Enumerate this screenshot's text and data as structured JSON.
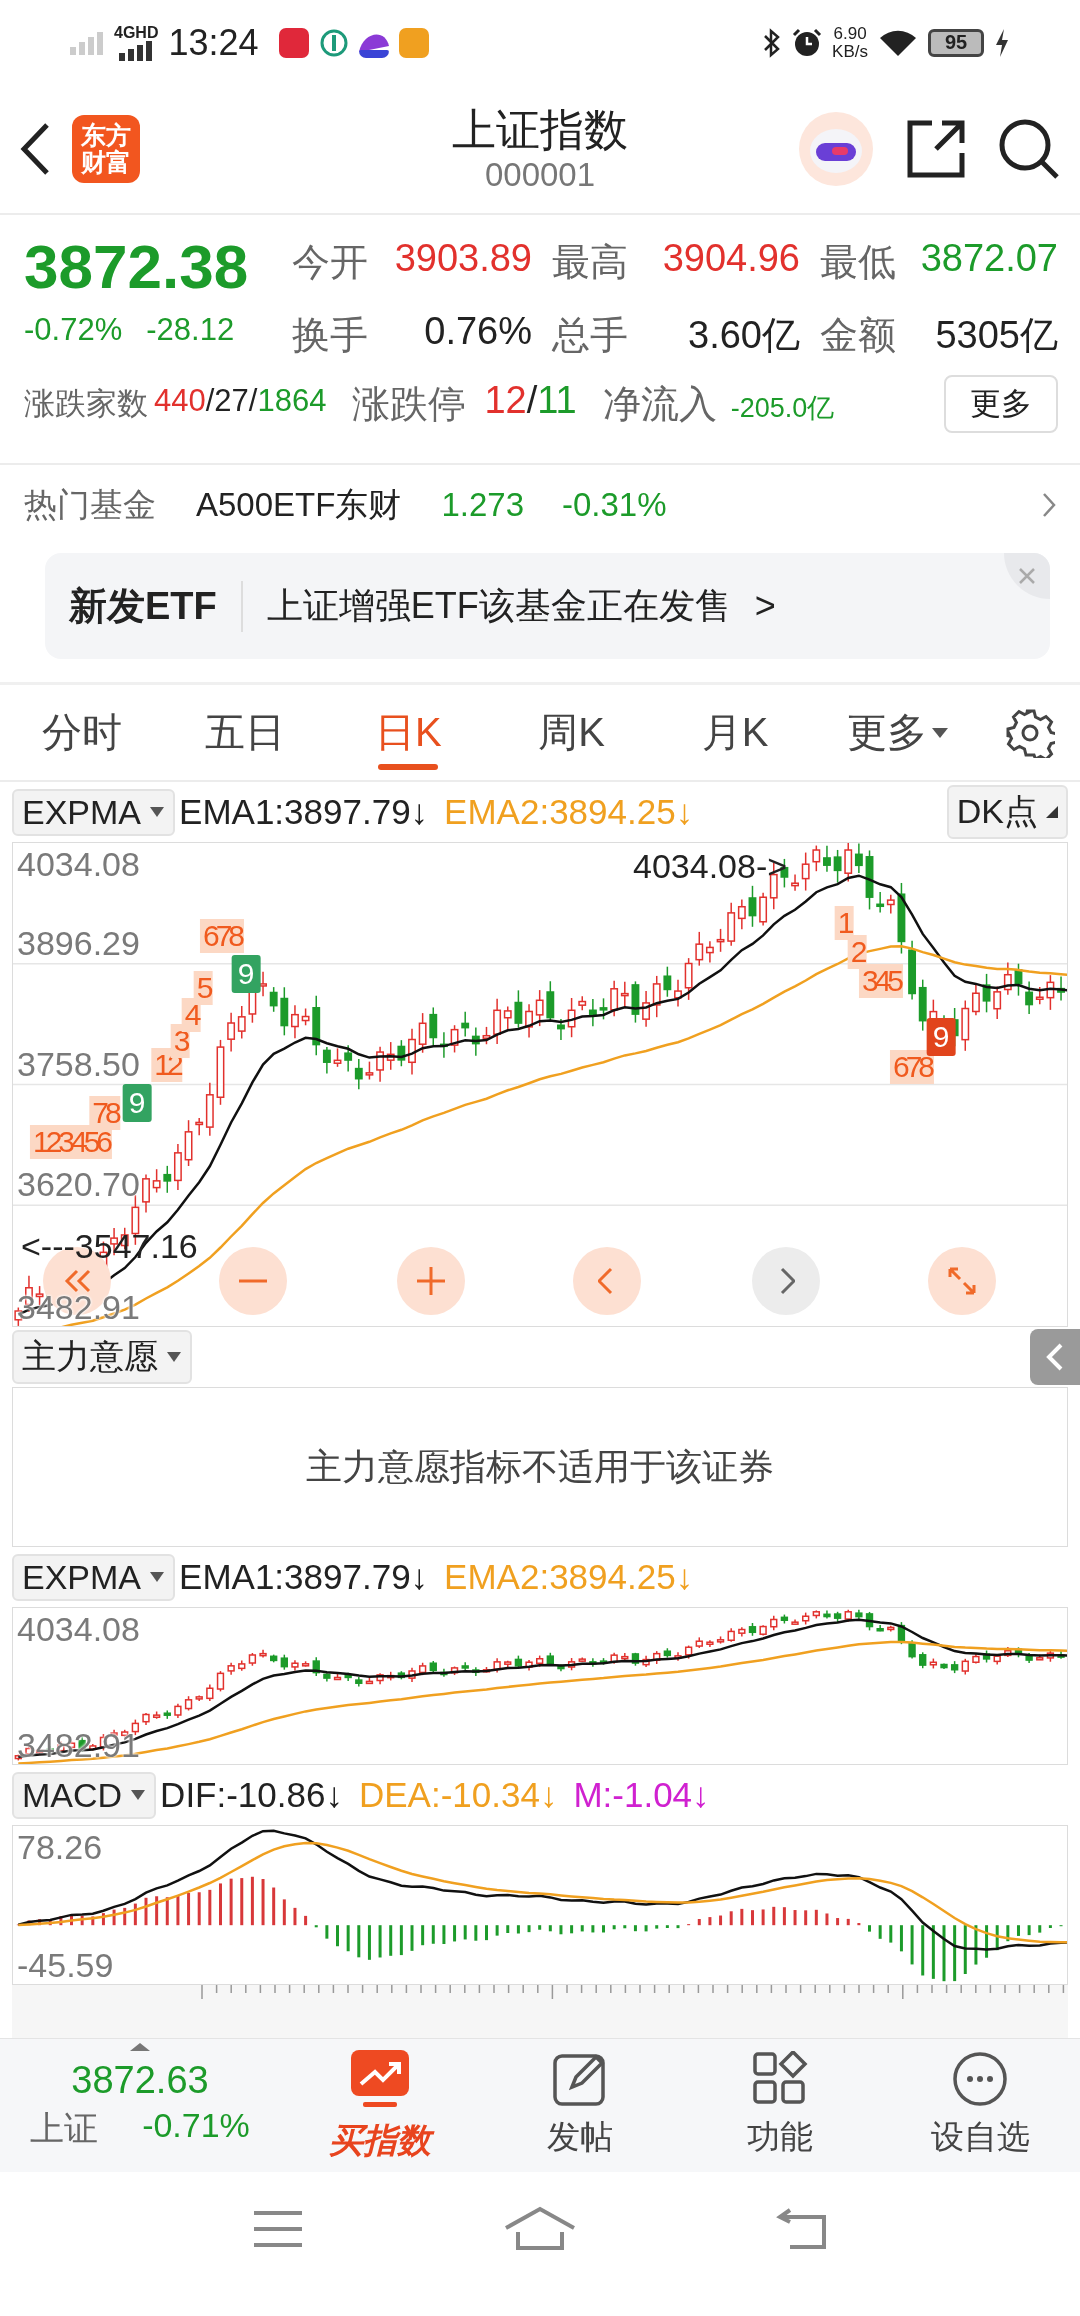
{
  "status_bar": {
    "network": "4GHD",
    "time": "13:24",
    "speed_value": "6.90",
    "speed_unit": "KB/s",
    "battery": "95"
  },
  "header": {
    "logo": "东方财富",
    "title": "上证指数",
    "code": "000001"
  },
  "quote": {
    "price": "3872.38",
    "change_pct": "-0.72%",
    "change": "-28.12",
    "stats": [
      {
        "label": "今开",
        "value": "3903.89",
        "color": "#e2312d"
      },
      {
        "label": "最高",
        "value": "3904.96",
        "color": "#e2312d"
      },
      {
        "label": "最低",
        "value": "3872.07",
        "color": "#1c9b2a"
      },
      {
        "label": "换手",
        "value": "0.76%",
        "color": "#222222"
      },
      {
        "label": "总手",
        "value": "3.60亿",
        "color": "#222222"
      },
      {
        "label": "金额",
        "value": "5305亿",
        "color": "#222222"
      }
    ],
    "breadth": {
      "label": "涨跌家数",
      "up": "440",
      "separator": "/",
      "flat": "27",
      "down": "1864"
    },
    "limit": {
      "label": "涨跌停",
      "up": "12",
      "separator": "/",
      "down": "11"
    },
    "net_inflow": {
      "label": "净流入",
      "value": "-205.0亿"
    },
    "more_button": "更多"
  },
  "hot_fund": {
    "label": "热门基金",
    "name": "A500ETF东财",
    "price": "1.273",
    "change": "-0.31%"
  },
  "banner": {
    "tag": "新发ETF",
    "text": "上证增强ETF该基金正在发售",
    "arrow": ">"
  },
  "tabs": [
    {
      "label": "分时",
      "selected": false
    },
    {
      "label": "五日",
      "selected": false
    },
    {
      "label": "日K",
      "selected": true
    },
    {
      "label": "周K",
      "selected": false
    },
    {
      "label": "月K",
      "selected": false
    },
    {
      "label": "更多",
      "selected": false,
      "kind": "dropdown"
    }
  ],
  "main_chart": {
    "indicator": "EXPMA",
    "ema1": "EMA1:3897.79↓",
    "ema2": "EMA2:3894.25↓",
    "dk_button": "DK点",
    "y_labels": [
      "4034.08",
      "3896.29",
      "3758.50",
      "3620.70",
      "3482.91"
    ],
    "high_marker": "4034.08->",
    "low_marker": "<---3547.16",
    "td_marks": [
      {
        "label": "123456",
        "kind": "plain"
      },
      {
        "label": "78",
        "kind": "plain"
      },
      {
        "label": "9",
        "kind": "buy-box"
      },
      {
        "label": "12",
        "kind": "plain"
      },
      {
        "label": "3",
        "kind": "plain"
      },
      {
        "label": "4",
        "kind": "plain"
      },
      {
        "label": "5",
        "kind": "plain"
      },
      {
        "label": "678",
        "kind": "plain"
      },
      {
        "label": "9",
        "kind": "buy-box"
      },
      {
        "label": "1",
        "kind": "plain"
      },
      {
        "label": "2",
        "kind": "plain"
      },
      {
        "label": "345",
        "kind": "plain"
      },
      {
        "label": "678",
        "kind": "plain"
      },
      {
        "label": "9",
        "kind": "sell-box"
      }
    ]
  },
  "intent_panel": {
    "selector": "主力意愿",
    "message": "主力意愿指标不适用于该证券"
  },
  "mini_chart": {
    "indicator": "EXPMA",
    "ema1": "EMA1:3897.79↓",
    "ema2": "EMA2:3894.25↓",
    "y_labels": [
      "4034.08",
      "3482.91"
    ]
  },
  "macd_chart": {
    "indicator": "MACD",
    "dif": "DIF:-10.86↓",
    "dea": "DEA:-10.34↓",
    "m": "M:-1.04↓",
    "y_labels": [
      "78.26",
      "-45.59"
    ]
  },
  "bottom_bar": {
    "quote_price": "3872.63",
    "quote_name": "上证",
    "quote_change": "-0.71%",
    "promo": "买指数",
    "actions": [
      {
        "label": "发帖",
        "kind": "post"
      },
      {
        "label": "功能",
        "kind": "apps"
      },
      {
        "label": "设自选",
        "kind": "more"
      }
    ]
  }
}
